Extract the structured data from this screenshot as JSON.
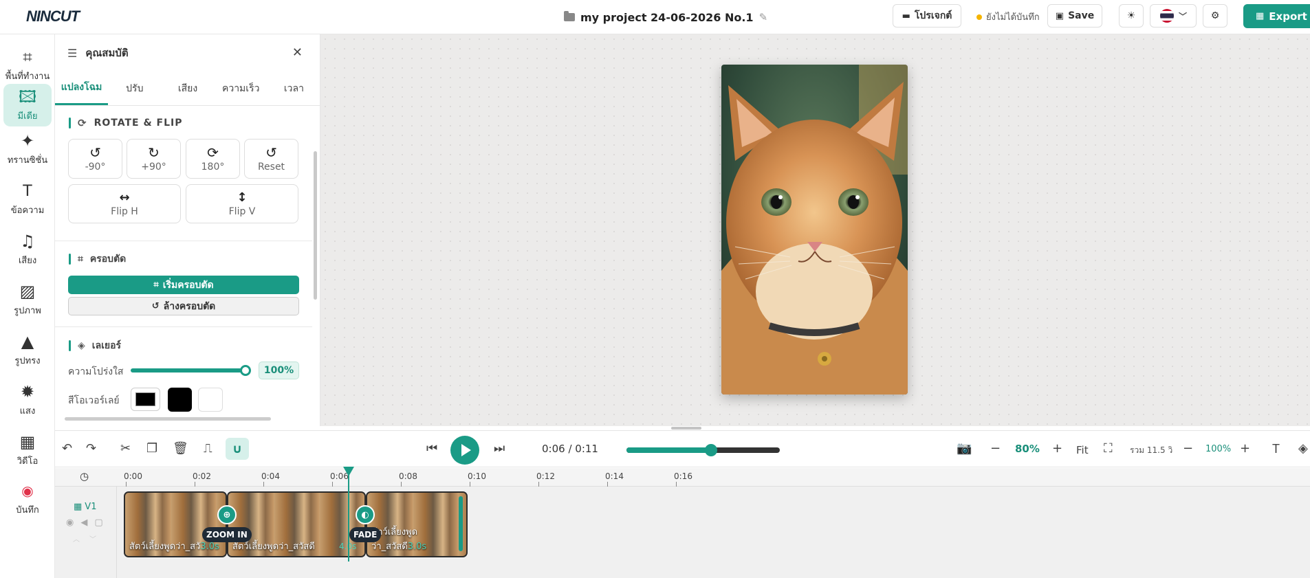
{
  "app": {
    "logo": "NINCUT"
  },
  "header": {
    "project_title": "my project 24-06-2026 No.1",
    "projects_label": "โปรเจกต์",
    "unsaved_label": "ยังไม่ได้บันทึก",
    "save_label": "Save",
    "export_label": "Export"
  },
  "sidebar": {
    "items": [
      {
        "label": "พื้นที่ทำงาน",
        "icon": "crop-icon"
      },
      {
        "label": "มีเดีย",
        "icon": "media-icon"
      },
      {
        "label": "ทรานซิชั่น",
        "icon": "magic-wand-icon"
      },
      {
        "label": "ข้อความ",
        "icon": "text-icon"
      },
      {
        "label": "เสียง",
        "icon": "music-icon"
      },
      {
        "label": "รูปภาพ",
        "icon": "image-icon"
      },
      {
        "label": "รูปทรง",
        "icon": "shapes-icon"
      },
      {
        "label": "แสง",
        "icon": "light-icon"
      },
      {
        "label": "วิดีโอ",
        "icon": "film-icon"
      },
      {
        "label": "บันทึก",
        "icon": "record-icon"
      }
    ],
    "active_index": 1
  },
  "panel": {
    "title": "คุณสมบัติ",
    "tabs": [
      "แปลงโฉม",
      "ปรับ",
      "เสียง",
      "ความเร็ว",
      "เวลา"
    ],
    "active_tab": 0,
    "rotate_flip": {
      "title": "ROTATE & FLIP",
      "buttons": [
        "-90°",
        "+90°",
        "180°",
        "Reset"
      ],
      "flip_h": "Flip H",
      "flip_v": "Flip V"
    },
    "crop": {
      "title": "ครอบตัด",
      "start_label": "เริ่มครอบตัด",
      "clear_label": "ล้างครอบตัด"
    },
    "layer": {
      "title": "เลเยอร์",
      "opacity_label": "ความโปร่งใส",
      "opacity_value": "100%",
      "opacity_fraction": 1.0,
      "overlay_color_label": "สีโอเวอร์เลย์",
      "swatches": [
        "#000000",
        "#000000",
        "#ffffff"
      ]
    }
  },
  "controls": {
    "time_display": "0:06 / 0:11",
    "progress_fraction": 0.55,
    "zoom_value": "80%",
    "fit_label": "Fit",
    "total_label": "รวม 11.5 วิ",
    "timeline_zoom": "100%"
  },
  "timeline": {
    "ruler": [
      "0:00",
      "0:02",
      "0:04",
      "0:06",
      "0:08",
      "0:10",
      "0:12",
      "0:14",
      "0:16"
    ],
    "track_label": "V1",
    "clips": [
      {
        "caption": "สัตว์เลี้ยงพูดว่า_สวั",
        "caption_tail": "3.0s"
      },
      {
        "caption": "สัตว์เลี้ยงพูดว่า_สวัสดี",
        "caption_tail": "4.0s"
      },
      {
        "caption": "สัตว์เลี้ยงพูดว่า_สวัสดี",
        "caption_tail": "3.0s"
      }
    ],
    "transitions": [
      {
        "label": "ZOOM IN"
      },
      {
        "label": "FADE"
      }
    ]
  },
  "colors": {
    "accent": "#1a9b86",
    "accent_light": "#d6f0ea",
    "dark": "#1f2a36"
  }
}
